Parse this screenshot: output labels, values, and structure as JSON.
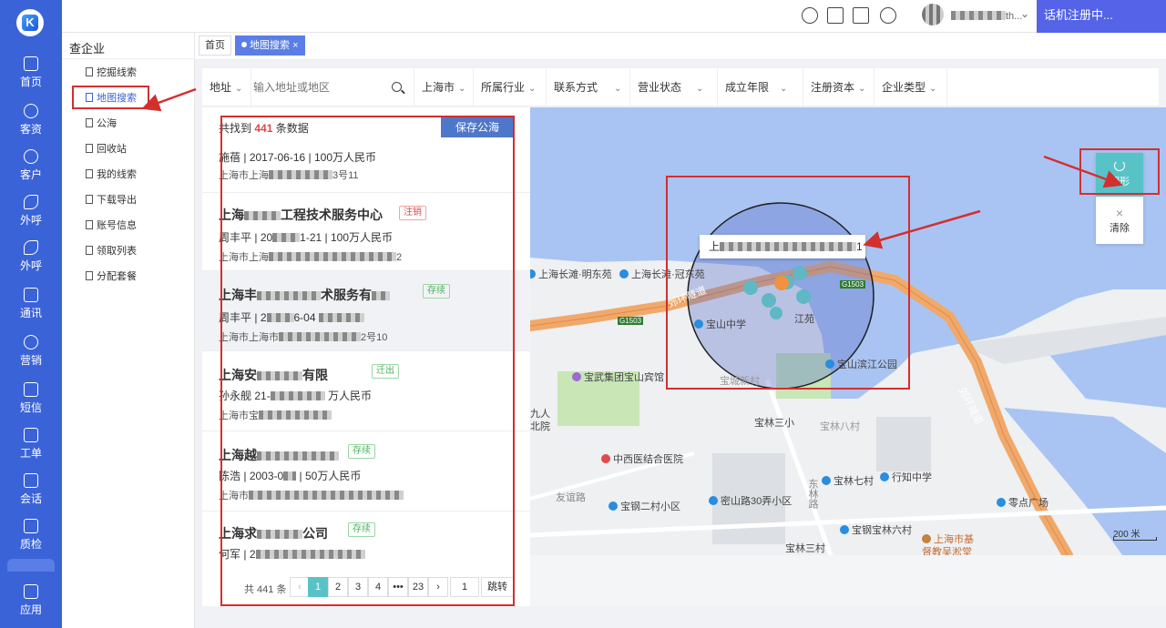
{
  "rail": {
    "items": [
      {
        "label": "首页",
        "icon": "home-icon"
      },
      {
        "label": "客资",
        "icon": "user-group-icon"
      },
      {
        "label": "客户",
        "icon": "customer-icon"
      },
      {
        "label": "外呼",
        "icon": "phone-out-icon"
      },
      {
        "label": "外呼",
        "icon": "phone-call-icon"
      },
      {
        "label": "通讯",
        "icon": "contacts-icon"
      },
      {
        "label": "营销",
        "icon": "marketing-icon"
      },
      {
        "label": "短信",
        "icon": "sms-icon"
      },
      {
        "label": "工单",
        "icon": "ticket-icon"
      },
      {
        "label": "会话",
        "icon": "chat-icon"
      },
      {
        "label": "质检",
        "icon": "quality-icon"
      },
      {
        "label": "应用",
        "icon": "apps-icon"
      }
    ]
  },
  "topbar": {
    "user_name": "th...",
    "status_label": "话机注册中..."
  },
  "submenu": {
    "title": "查企业",
    "items": [
      "挖掘线索",
      "地图搜索",
      "公海",
      "回收站",
      "我的线索",
      "下载导出",
      "账号信息",
      "领取列表",
      "分配套餐"
    ]
  },
  "tabs": {
    "home": "首页",
    "active": "地图搜索",
    "close": "×"
  },
  "filters": {
    "address_label": "地址",
    "search_placeholder": "输入地址或地区",
    "city": "上海市",
    "items": [
      "所属行业",
      "联系方式",
      "营业状态",
      "成立年限",
      "注册资本",
      "企业类型"
    ]
  },
  "results": {
    "prefix": "共找到",
    "count": "441",
    "suffix": "条数据",
    "save_label": "保存公海",
    "cards": [
      {
        "name": "",
        "person": "施蓓",
        "date": "2017-06-16",
        "capital": "100万人民币",
        "address": "上海市上海",
        "address_tail": "3号11",
        "tag": ""
      },
      {
        "name": "上海",
        "name_tail": "工程技术服务中心",
        "tag": "注销",
        "person": "周丰平",
        "date": "20",
        "date_tail": "1-21",
        "capital": "100万人民币",
        "address": "上海市上海",
        "address_tail": "2"
      },
      {
        "name": "上海丰",
        "name_tail": "术服务有",
        "tag": "存续",
        "person": "周丰平",
        "date": "2",
        "date_tail": "6-04",
        "capital": "",
        "address": "上海市上海市",
        "address_tail": "2号10"
      },
      {
        "name": "上海安",
        "name_tail": "有限",
        "tag": "迁出",
        "person": "孙永舰",
        "date": "21-",
        "date_tail": "",
        "capital": "万人民币",
        "address": "上海市宝",
        "address_tail": ""
      },
      {
        "name": "上海越",
        "name_tail": "",
        "tag": "存续",
        "person": "陈浩",
        "date": "2003-0",
        "date_tail": "",
        "capital": "50万人民币",
        "address": "上海市",
        "address_tail": ""
      },
      {
        "name": "上海求",
        "name_tail": "公司",
        "tag": "存续",
        "person": "何军",
        "date": "2",
        "date_tail": "",
        "capital": "",
        "address": "",
        "address_tail": ""
      }
    ]
  },
  "pager": {
    "total": "共 441 条",
    "pages": [
      "1",
      "2",
      "3",
      "4",
      "•••",
      "23"
    ],
    "prev": "‹",
    "next": "›",
    "jump_value": "1",
    "jump_label": "跳转"
  },
  "map": {
    "tooltip": "上",
    "tooltip_tail": "1",
    "pois": [
      "上海长滩·明东苑",
      "上海长滩·冠东苑",
      "宝山中学",
      "宝武集团宝山宾馆",
      "宝城新村",
      "宝山滨江公园",
      "宝林三小",
      "宝林八村",
      "九人",
      "北院",
      "中西医结合医院",
      "宝林七村",
      "行知中学",
      "友谊路",
      "宝钢二村小区",
      "密山路30弄小区",
      "东林路",
      "零点广场",
      "宝钢宝林六村",
      "宝林三村",
      "上海市基",
      "督教吴淞堂",
      "江苑",
      "逸仙路",
      "G1503",
      "G1503"
    ],
    "road_labels": [
      "郊环隧道",
      "郊环隧道"
    ],
    "tool_circle": "圆形",
    "tool_clear": "清除",
    "clear_icon": "×",
    "scale": "200 米",
    "colors": {
      "water": "#a9c4f2",
      "land": "#eef0f2",
      "road": "#f0a96a",
      "circle_fill": "rgba(90,110,200,0.35)"
    }
  }
}
